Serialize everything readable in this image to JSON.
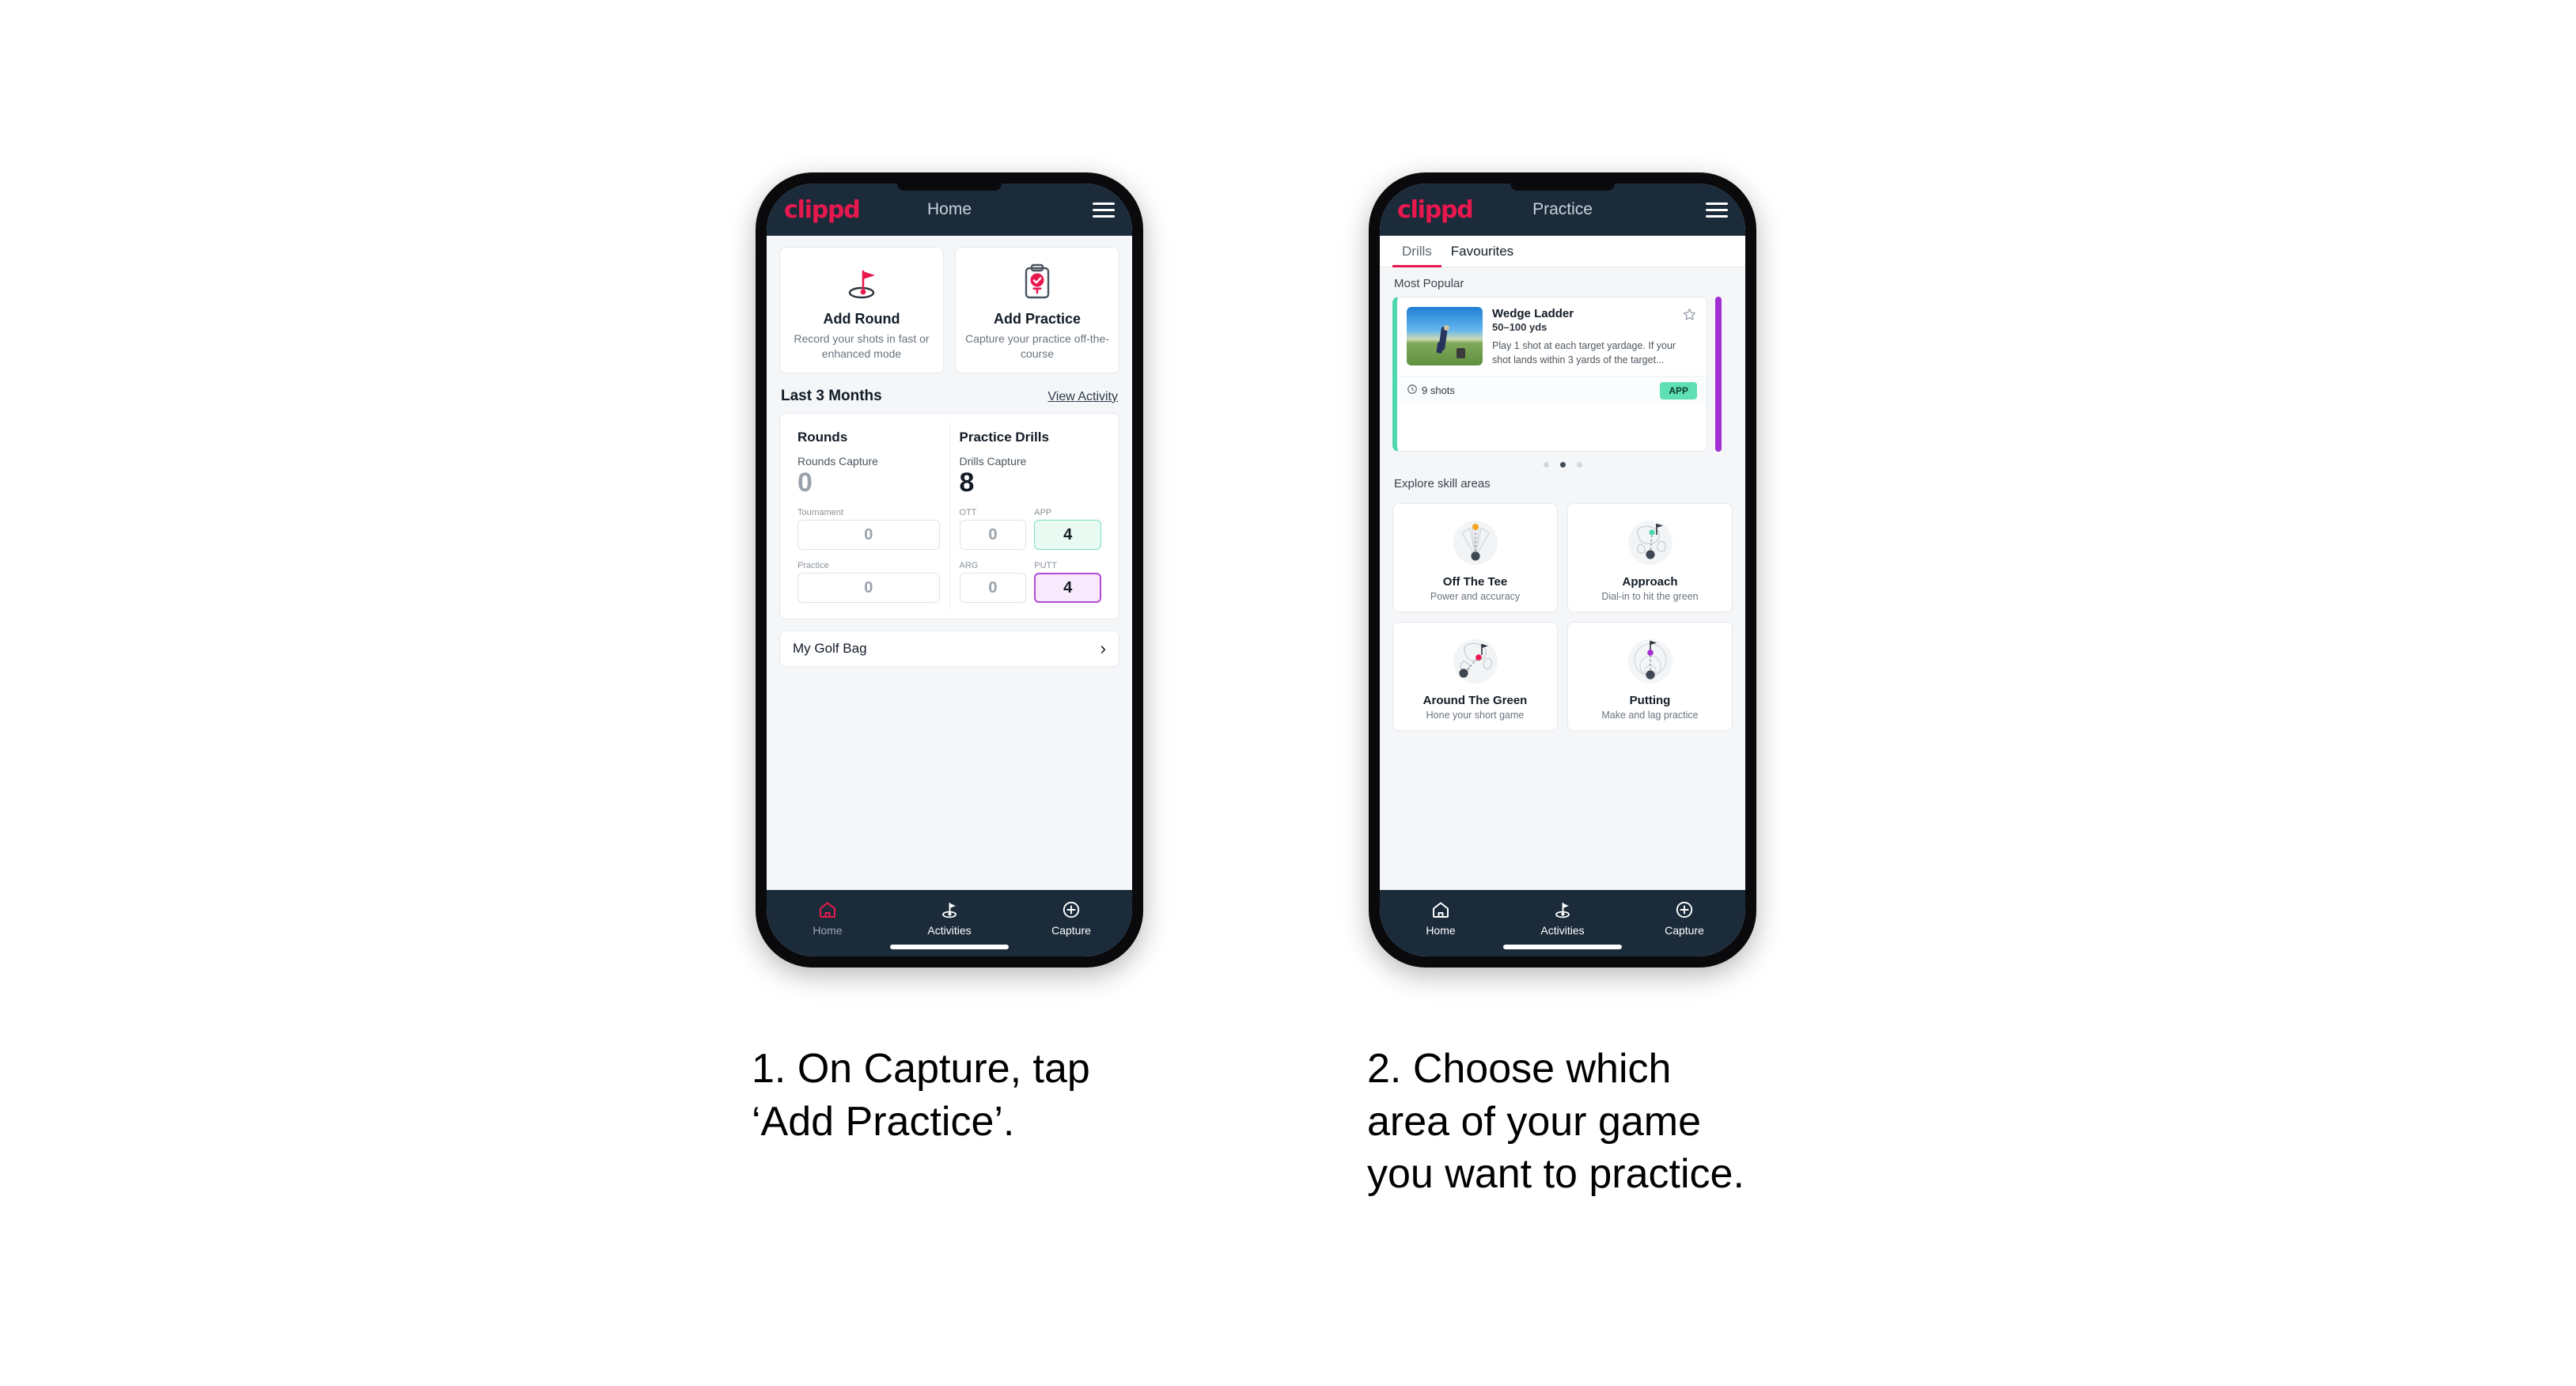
{
  "brand": "clippd",
  "phone1": {
    "header": {
      "title": "Home",
      "menu_icon": "hamburger-icon"
    },
    "quick_actions": [
      {
        "icon": "golf-flag-icon",
        "title": "Add Round",
        "subtitle": "Record your shots in fast or enhanced mode"
      },
      {
        "icon": "clipboard-check-icon",
        "title": "Add Practice",
        "subtitle": "Capture your practice off-the-course"
      }
    ],
    "section": {
      "title": "Last 3 Months",
      "link": "View Activity"
    },
    "stats": {
      "rounds": {
        "heading": "Rounds",
        "capture_label": "Rounds Capture",
        "capture_value": "0",
        "fields": [
          {
            "label": "Tournament",
            "value": "0",
            "style": "plain"
          },
          {
            "label": "Practice",
            "value": "0",
            "style": "plain"
          }
        ]
      },
      "drills": {
        "heading": "Practice Drills",
        "capture_label": "Drills Capture",
        "capture_value": "8",
        "fields": [
          {
            "label": "OTT",
            "value": "0",
            "style": "plain"
          },
          {
            "label": "APP",
            "value": "4",
            "style": "green"
          },
          {
            "label": "ARG",
            "value": "0",
            "style": "plain"
          },
          {
            "label": "PUTT",
            "value": "4",
            "style": "purple"
          }
        ]
      }
    },
    "golf_bag": {
      "label": "My Golf Bag",
      "chevron": "chevron-right-icon"
    },
    "nav": [
      {
        "icon": "home-icon",
        "label": "Home",
        "active": true
      },
      {
        "icon": "golf-flag-icon",
        "label": "Activities",
        "active": false
      },
      {
        "icon": "plus-circle-icon",
        "label": "Capture",
        "active": false
      }
    ]
  },
  "phone2": {
    "header": {
      "title": "Practice",
      "menu_icon": "hamburger-icon"
    },
    "tabs": [
      {
        "label": "Drills",
        "active": true
      },
      {
        "label": "Favourites",
        "active": false
      }
    ],
    "most_popular_label": "Most Popular",
    "drill": {
      "title": "Wedge Ladder",
      "yardage": "50–100 yds",
      "description": "Play 1 shot at each target yardage. If your shot lands within 3 yards of the target...",
      "shots": "9 shots",
      "badge": "APP",
      "star_icon": "star-outline-icon",
      "clock_icon": "clock-icon",
      "accent_color": "#4fd8ae",
      "next_card_accent": "#a32fd4"
    },
    "carousel_dots": {
      "count": 3,
      "active_index": 1
    },
    "explore_label": "Explore skill areas",
    "skill_areas": [
      {
        "icon": "off-the-tee-icon",
        "title": "Off The Tee",
        "subtitle": "Power and accuracy",
        "dot_color": "#f5a623"
      },
      {
        "icon": "approach-icon",
        "title": "Approach",
        "subtitle": "Dial-in to hit the green",
        "dot_color": "#4fd8ae"
      },
      {
        "icon": "around-the-green-icon",
        "title": "Around The Green",
        "subtitle": "Hone your short game",
        "dot_color": "#e8184e"
      },
      {
        "icon": "putting-icon",
        "title": "Putting",
        "subtitle": "Make and lag practice",
        "dot_color": "#a32fd4"
      }
    ],
    "nav": [
      {
        "icon": "home-icon",
        "label": "Home",
        "active": false
      },
      {
        "icon": "golf-flag-icon",
        "label": "Activities",
        "active": false
      },
      {
        "icon": "plus-circle-icon",
        "label": "Capture",
        "active": false
      }
    ]
  },
  "captions": [
    "1. On Capture, tap\n‘Add Practice’.",
    "2. Choose which\narea of your game\nyou want to practice."
  ],
  "colors": {
    "brand_pink": "#e8184e",
    "header_navy": "#1b2b3a",
    "app_bg": "#f4f6f8",
    "green_accent": "#4fd8ae",
    "purple_accent": "#a32fd4"
  }
}
